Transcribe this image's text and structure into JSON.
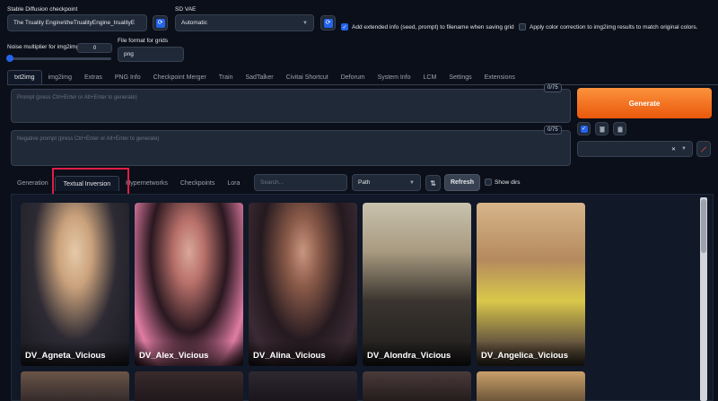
{
  "settings": {
    "checkpoint_label": "Stable Diffusion checkpoint",
    "checkpoint_value": "The Truality Engine\\theTrualityEngine_trualityE",
    "vae_label": "SD VAE",
    "vae_value": "Automatic",
    "extended_info_label": "Add extended info (seed, prompt) to filename when saving grid",
    "extended_info_checked": true,
    "color_correction_label": "Apply color correction to img2img results to match original colors.",
    "color_correction_checked": false,
    "noise_label": "Noise multiplier for img2img",
    "noise_value": "0",
    "file_format_label": "File format for grids",
    "file_format_value": "png"
  },
  "main_tabs": [
    "txt2img",
    "img2img",
    "Extras",
    "PNG Info",
    "Checkpoint Merger",
    "Train",
    "SadTalker",
    "Civitai Shortcut",
    "Deforum",
    "System Info",
    "LCM",
    "Settings",
    "Extensions"
  ],
  "active_main_tab": "txt2img",
  "prompt": {
    "placeholder": "Prompt (press Ctrl+Enter or Alt+Enter to generate)",
    "counter": "0/75"
  },
  "negative_prompt": {
    "placeholder": "Negative prompt (press Ctrl+Enter or Alt+Enter to generate)",
    "counter": "0/75"
  },
  "generate_label": "Generate",
  "extra_tabs": [
    "Generation",
    "Textual Inversion",
    "Hypernetworks",
    "Checkpoints",
    "Lora"
  ],
  "active_extra_tab": "Textual Inversion",
  "extra_tools": {
    "search_placeholder": "Search...",
    "sort_value": "Path",
    "refresh_label": "Refresh",
    "show_dirs_label": "Show dirs"
  },
  "cards": [
    {
      "name": "DV_Agneta_Vicious"
    },
    {
      "name": "DV_Alex_Vicious"
    },
    {
      "name": "DV_Alina_Vicious"
    },
    {
      "name": "DV_Alondra_Vicious"
    },
    {
      "name": "DV_Angelica_Vicious"
    }
  ],
  "colors": {
    "background": "#0b0f19",
    "accent_orange": "#f97316",
    "highlight_red": "#e11d48",
    "checkbox_blue": "#2563eb"
  }
}
